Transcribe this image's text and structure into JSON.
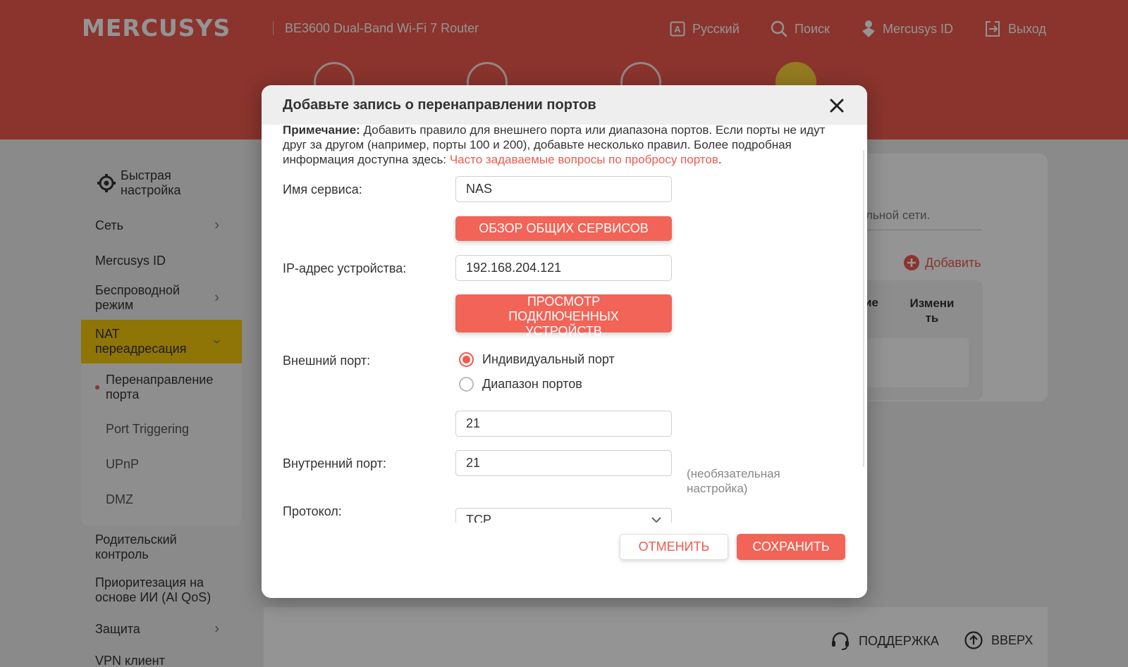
{
  "header": {
    "logo": "MERCUSYS",
    "model": "BE3600 Dual-Band Wi-Fi 7 Router",
    "language": "Русский",
    "search": "Поиск",
    "mercusys_id": "Mercusys ID",
    "logout": "Выход",
    "accent_color": "#ee5a4e"
  },
  "sidebar": {
    "quick_setup": "Быстрая настройка",
    "network": "Сеть",
    "mercusys_id": "Mercusys ID",
    "wireless": "Беспроводной режим",
    "nat": "NAT переадресация",
    "nat_sub": [
      "Перенаправление порта",
      "Port Triggering",
      "UPnP",
      "DMZ"
    ],
    "parental": "Родительский контроль",
    "ai_qos": "Приоритезация на основе ИИ (AI QoS)",
    "security": "Защита",
    "vpn": "VPN клиент",
    "active_color": "#f7c90b"
  },
  "background": {
    "desc_fragment": "льной сети.",
    "add": "Добавить",
    "col_fragment": "ие",
    "col_edit": "Измени ть"
  },
  "footer": {
    "support": "ПОДДЕРЖКА",
    "top": "ВВЕРХ"
  },
  "modal": {
    "title": "Добавьте запись о перенаправлении портов",
    "note_label": "Примечание:",
    "note_text": " Добавить правило для внешнего порта или диапазона портов. Если порты не идут друг за другом (например, порты 100 и 200), добавьте несколько правил. Более подробная информация доступна здесь: ",
    "note_link": "Часто задаваемые вопросы по пробросу портов",
    "note_end": ".",
    "service_name_label": "Имя сервиса:",
    "service_name_value": "NAS",
    "browse_services": "ОБЗОР ОБЩИХ СЕРВИСОВ",
    "ip_label": "IP-адрес устройства:",
    "ip_value": "192.168.204.121",
    "view_devices": "ПРОСМОТР ПОДКЛЮЧЕННЫХ УСТРОЙСТВ",
    "external_port_label": "Внешний порт:",
    "radio_single": "Индивидуальный порт",
    "radio_range": "Диапазон портов",
    "external_port_value": "21",
    "internal_port_label": "Внутренний порт:",
    "internal_port_value": "21",
    "optional_hint": "(необязательная настройка)",
    "protocol_label": "Протокол:",
    "protocol_value": "TCP",
    "cancel": "ОТМЕНИТЬ",
    "save": "СОХРАНИТЬ"
  }
}
